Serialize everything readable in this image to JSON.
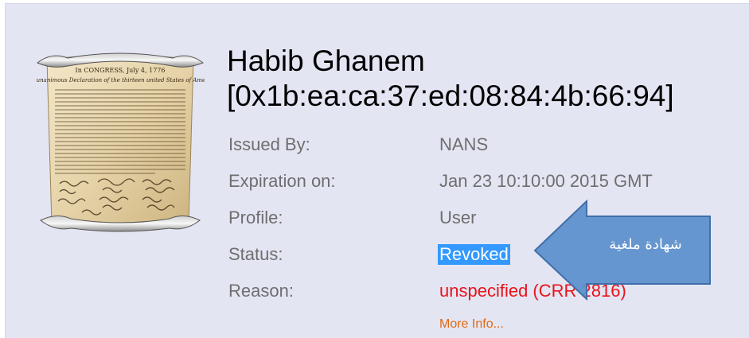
{
  "certificate": {
    "holder_name": "Habib Ghanem",
    "serial": "[0x1b:ea:ca:37:ed:08:84:4b:66:94]",
    "image_icon": "declaration-document-icon"
  },
  "details": {
    "issued_by_label": "Issued By:",
    "issued_by_value": "NANS",
    "expiration_label": "Expiration on:",
    "expiration_value": "Jan 23 10:10:00 2015 GMT",
    "profile_label": "Profile:",
    "profile_value": "User",
    "status_label": "Status:",
    "status_value": "Revoked",
    "reason_label": "Reason:",
    "reason_value": "unspecified (CRR 2816)"
  },
  "more_info_label": "More Info...",
  "annotation": {
    "text": "شهادة ملغية",
    "icon": "left-arrow-callout-icon"
  },
  "colors": {
    "panel_background": "#e4e5f3",
    "label_text": "#6e6e6e",
    "selection_highlight": "#3399ff",
    "reason_red": "#e8141b",
    "link_orange": "#e06a12",
    "callout_fill": "#5b8fcc",
    "callout_border": "#3f6fa8"
  }
}
